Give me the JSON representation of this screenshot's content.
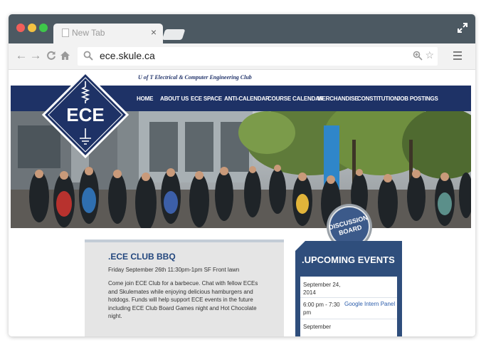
{
  "browser": {
    "tab_title": "New Tab",
    "tab_close": "×",
    "url": "ece.skule.ca"
  },
  "site": {
    "club_title": "U of T Electrical & Computer Engineering Club",
    "logo_text": "ECE",
    "nav": [
      "HOME",
      "ABOUT US",
      "ECE SPACE",
      "ANTI-CALENDAR",
      "COURSE CALENDAR",
      "MERCHANDISE",
      "CONSTITUTION",
      "JOB POSTINGS"
    ],
    "badge": [
      "DISCUSSION",
      "BOARD"
    ],
    "post": {
      "title": ".ECE CLUB BBQ",
      "date": "Friday September 26th 11:30pm-1pm SF Front lawn",
      "body": "Come join ECE Club for a barbecue. Chat with fellow ECEs and Skulemates while enjoying delicious hamburgers and hotdogs. Funds will help support ECE events in the future including ECE Club Board Games night and Hot Chocolate night."
    },
    "events": {
      "title": ".UPCOMING EVENTS",
      "items": [
        {
          "date": "September 24, 2014",
          "time": "6:00 pm - 7:30 pm",
          "name": "Google Intern Panel"
        },
        {
          "date": "September"
        }
      ]
    }
  },
  "colors": {
    "titlebar": "#4c5962",
    "navbar": "#1e3266",
    "accent": "#2f4e7c",
    "link": "#2a5cab"
  }
}
